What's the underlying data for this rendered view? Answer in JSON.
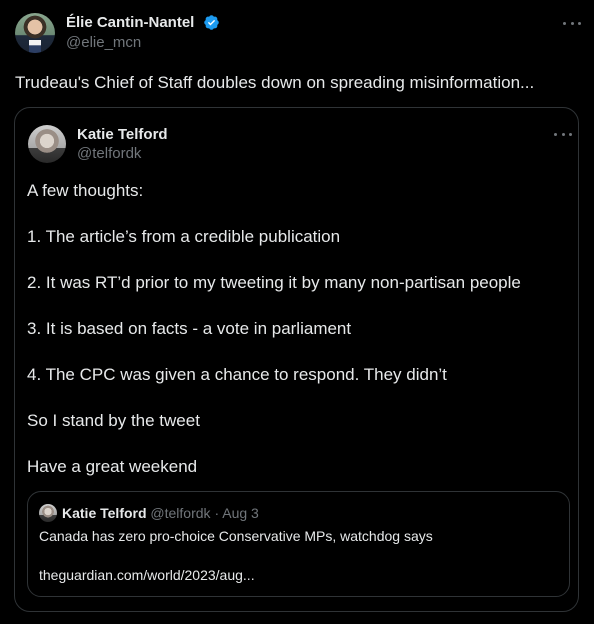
{
  "tweet": {
    "author_name": "Élie Cantin-Nantel",
    "author_handle": "@elie_mcn",
    "text": "Trudeau's Chief of Staff doubles down on spreading misinformation..."
  },
  "quote": {
    "author_name": "Katie Telford",
    "author_handle": "@telfordk",
    "lines": [
      "A few thoughts:",
      "1. The article’s from a credible publication",
      "2. It was RT’d prior to my tweeting it by many non-partisan people",
      "3. It is based on facts - a vote in parliament",
      "4. The CPC was given a chance to respond. They didn’t",
      "So I stand by the tweet",
      "Have a great weekend"
    ],
    "nested": {
      "author_name": "Katie Telford",
      "author_handle": "@telfordk",
      "separator": "·",
      "date": "Aug 3",
      "title": "Canada has zero pro-choice Conservative MPs, watchdog says",
      "link": "theguardian.com/world/2023/aug..."
    }
  },
  "colors": {
    "background": "#000000",
    "text_primary": "#e7e9ea",
    "text_secondary": "#71767b",
    "border": "#2f3336",
    "verified_badge": "#1d9bf0"
  },
  "icons": {
    "verified": "verified-badge-icon",
    "more": "more-options-icon"
  }
}
